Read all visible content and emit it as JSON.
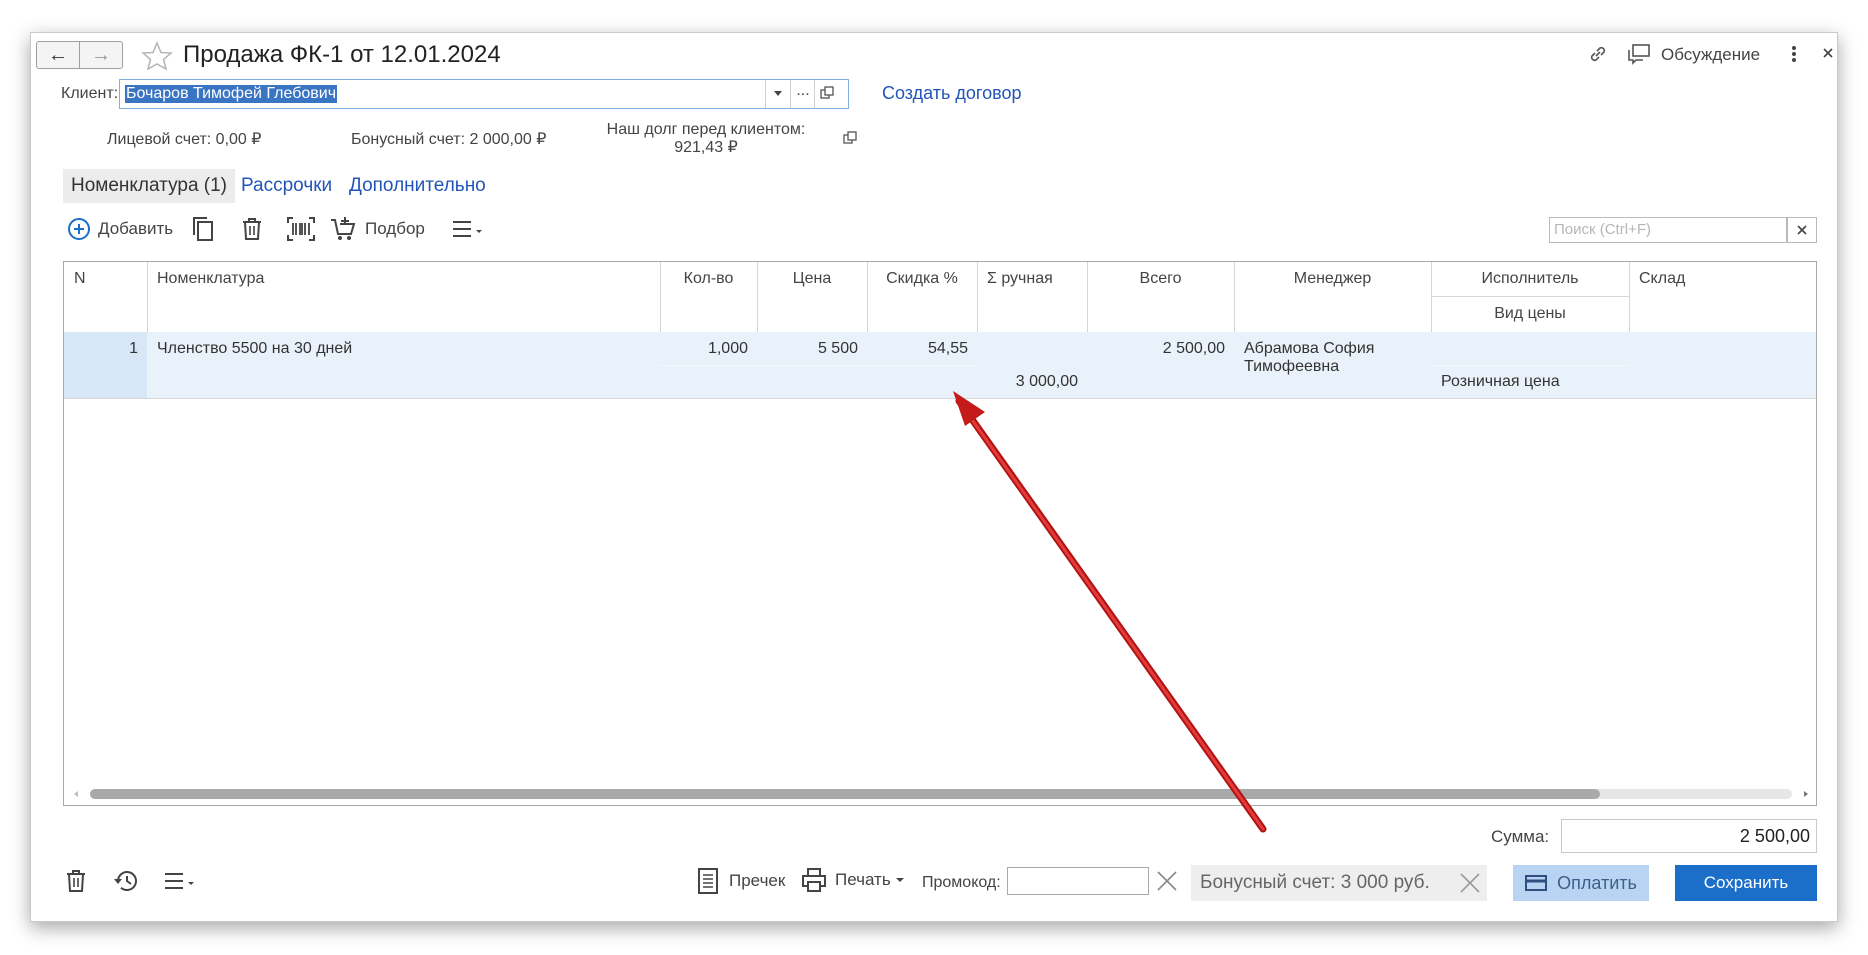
{
  "window": {
    "title": "Продажа ФК-1 от 12.01.2024",
    "discussion_label": "Обсуждение",
    "back_icon": "←",
    "forward_icon": "→"
  },
  "client": {
    "label": "Клиент:",
    "value": "Бочаров Тимофей Глебович",
    "create_contract": "Создать договор"
  },
  "accounts": {
    "personal": "Лицевой счет: 0,00 ₽",
    "bonus": "Бонусный счет: 2 000,00 ₽",
    "debt_label": "Наш долг перед клиентом:",
    "debt_value": "921,43 ₽"
  },
  "tabs": [
    {
      "label": "Номенклатура (1)",
      "active": true
    },
    {
      "label": "Рассрочки",
      "active": false
    },
    {
      "label": "Дополнительно",
      "active": false
    }
  ],
  "toolbar": {
    "add_label": "Добавить",
    "pick_label": "Подбор",
    "search_placeholder": "Поиск (Ctrl+F)"
  },
  "table": {
    "headers": {
      "n": "N",
      "item": "Номенклатура",
      "qty": "Кол-во",
      "price": "Цена",
      "discount": "Скидка %",
      "manual_sum": "Σ ручная",
      "total": "Всего",
      "manager": "Менеджер",
      "executor": "Исполнитель",
      "price_type": "Вид цены",
      "warehouse": "Склад"
    },
    "rows": [
      {
        "n": "1",
        "item": "Членство 5500 на 30 дней",
        "qty": "1,000",
        "price": "5 500",
        "discount": "54,55",
        "manual_sum": "3 000,00",
        "total": "2 500,00",
        "manager_line1": "Абрамова София",
        "manager_line2": "Тимофеевна",
        "executor": "",
        "price_type": "Розничная цена",
        "warehouse": ""
      }
    ]
  },
  "summary": {
    "sum_label": "Сумма:",
    "sum_value": "2 500,00"
  },
  "footer": {
    "precheck": "Пречек",
    "print": "Печать",
    "promo_label": "Промокод:",
    "bonus_status": "Бонусный счет: 3 000 руб.",
    "pay": "Оплатить",
    "save": "Сохранить"
  },
  "colors": {
    "accent_blue": "#1c6fc9",
    "link_blue": "#2255b8",
    "selected_row": "#e9f1fa",
    "row_number_bg": "#d7e7f8",
    "pay_bg": "#b8d4f2",
    "arrow_red": "#d11a1a"
  }
}
